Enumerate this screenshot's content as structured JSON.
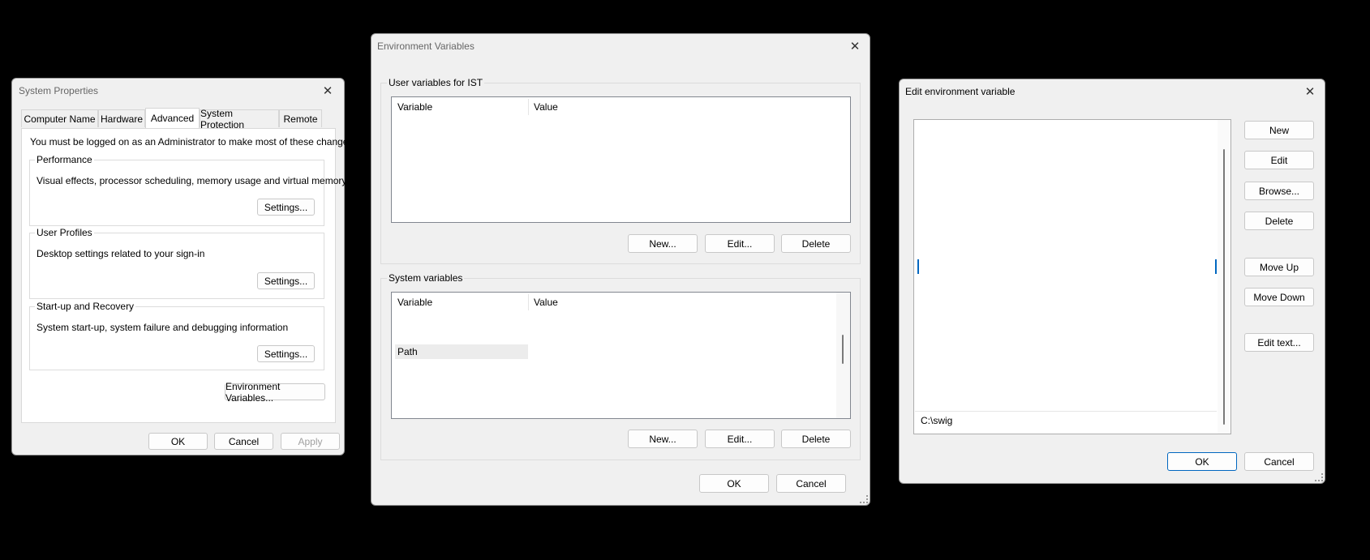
{
  "system_properties": {
    "title": "System Properties",
    "tabs": [
      "Computer Name",
      "Hardware",
      "Advanced",
      "System Protection",
      "Remote"
    ],
    "admin_note": "You must be logged on as an Administrator to make most of these changes.",
    "performance": {
      "label": "Performance",
      "description": "Visual effects, processor scheduling, memory usage and virtual memory",
      "settings_button": "Settings..."
    },
    "user_profiles": {
      "label": "User Profiles",
      "description": "Desktop settings related to your sign-in",
      "settings_button": "Settings..."
    },
    "startup_recovery": {
      "label": "Start-up and Recovery",
      "description": "System start-up, system failure and debugging information",
      "settings_button": "Settings..."
    },
    "env_vars_button": "Environment Variables...",
    "ok": "OK",
    "cancel": "Cancel",
    "apply": "Apply"
  },
  "env_vars": {
    "title": "Environment Variables",
    "user_group_label": "User variables for IST",
    "user_columns": [
      "Variable",
      "Value"
    ],
    "system_group_label": "System variables",
    "system_columns": [
      "Variable",
      "Value"
    ],
    "system_selected_variable": "Path",
    "new": "New...",
    "edit": "Edit...",
    "delete": "Delete",
    "ok": "OK",
    "cancel": "Cancel"
  },
  "edit_env": {
    "title": "Edit environment variable",
    "last_entry": "C:\\swig",
    "buttons": {
      "new": "New",
      "edit": "Edit",
      "browse": "Browse...",
      "delete": "Delete",
      "move_up": "Move Up",
      "move_down": "Move Down",
      "edit_text": "Edit text..."
    },
    "ok": "OK",
    "cancel": "Cancel"
  },
  "colors": {
    "dialog_bg": "#f0f0f0",
    "accent": "#0067c0",
    "selection": "#ececec"
  }
}
